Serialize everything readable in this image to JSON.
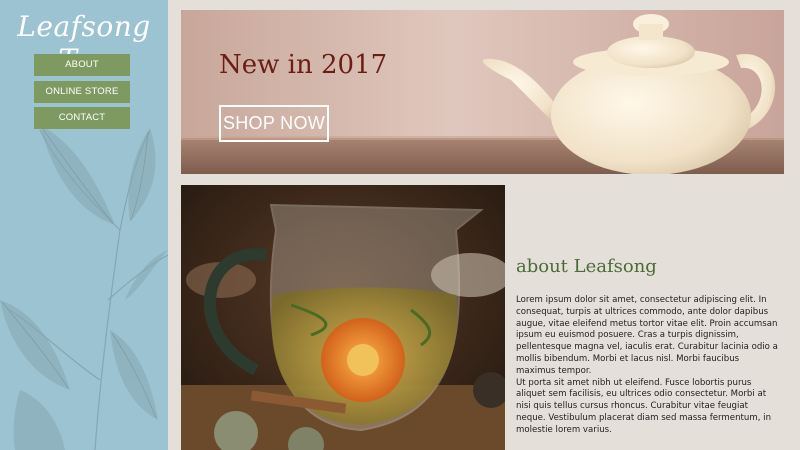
{
  "brand": {
    "name": "Leafsong Tea"
  },
  "nav": {
    "items": [
      {
        "label": "ABOUT"
      },
      {
        "label": "ONLINE STORE"
      },
      {
        "label": "CONTACT"
      }
    ]
  },
  "banner": {
    "title": "New in 2017",
    "cta_label": "SHOP NOW"
  },
  "about": {
    "heading": "about Leafsong",
    "paragraph_1": "Lorem ipsum dolor sit amet, consectetur adipiscing elit. In consequat, turpis at ultrices commodo, ante dolor dapibus augue, vitae eleifend metus tortor vitae elit. Proin accumsan ipsum eu euismod posuere. Cras a turpis dignissim, pellentesque magna vel, iaculis erat. Curabitur lacinia odio a mollis bibendum. Morbi et lacus nisl. Morbi faucibus maximus tempor.",
    "paragraph_2": "Ut porta sit amet nibh ut eleifend. Fusce lobortis purus aliquet sem facilisis, eu ultrices odio consectetur. Morbi at nisi quis tellus cursus rhoncus. Curabitur vitae feugiat neque. Vestibulum placerat diam sed massa fermentum, in molestie lorem varius."
  },
  "colors": {
    "sidebar": "#9cc3d1",
    "nav_button": "#7e9a60",
    "page_background": "#e4e0d9",
    "banner_title": "#6b1e14",
    "about_heading": "#4b6a38"
  },
  "icons": {
    "sidebar_art": "tea-plant-illustration",
    "banner_image": "teapot-photo",
    "photo": "glass-teapot-flower-tea-photo"
  }
}
